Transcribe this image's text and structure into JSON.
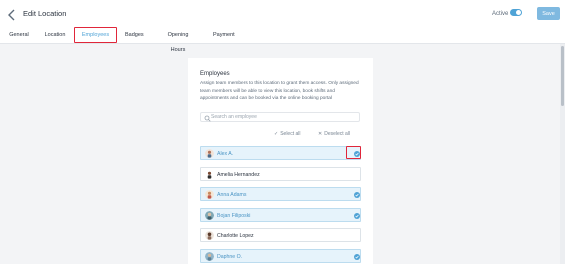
{
  "header": {
    "title": "Edit Location",
    "active_label": "Active",
    "active_on": true,
    "save_label": "Save"
  },
  "tabs": [
    {
      "label": "General",
      "active": false
    },
    {
      "label": "Location",
      "active": false
    },
    {
      "label": "Employees",
      "active": true
    },
    {
      "label": "Badges",
      "active": false
    },
    {
      "label": "Opening Hours",
      "active": false
    },
    {
      "label": "Payment",
      "active": false
    }
  ],
  "employees_section": {
    "title": "Employees",
    "description": "Assign team members to this location to grant them access. Only assigned team members will be able to view this location, book shifts and appointments and can be booked via the online booking portal",
    "search_placeholder": "Search an employee",
    "select_all_label": "Select all",
    "deselect_all_label": "Deselect all",
    "employees": [
      {
        "name": "Alex A.",
        "selected": true
      },
      {
        "name": "Amelia Hernandez",
        "selected": false
      },
      {
        "name": "Anna Adams",
        "selected": true
      },
      {
        "name": "Bojan Filiposki",
        "selected": true
      },
      {
        "name": "Charlotte Lopez",
        "selected": false
      },
      {
        "name": "Daphne O.",
        "selected": true
      }
    ]
  },
  "colors": {
    "accent": "#4fa3d6",
    "highlight": "#e0263a",
    "selected_row": "#e6f3fb"
  }
}
